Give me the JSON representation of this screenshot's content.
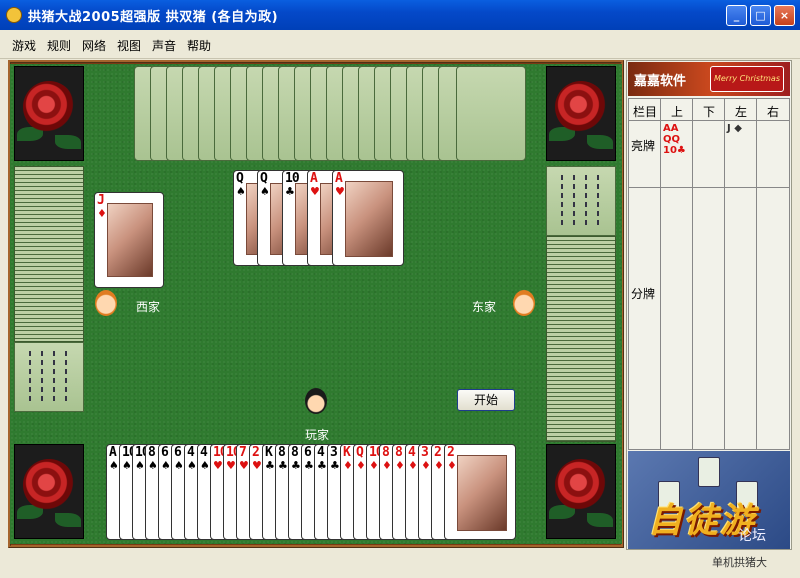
{
  "window": {
    "title": "拱猪大战2005超强版  拱双猪 (各自为政)",
    "min_label": "_",
    "max_label": "□",
    "close_label": "×"
  },
  "menu": [
    "游戏",
    "规则",
    "网络",
    "视图",
    "声音",
    "帮助"
  ],
  "players": {
    "west": "西家",
    "east": "东家",
    "me": "玩家"
  },
  "start_button": "开始",
  "west_card": {
    "rank": "J",
    "suit": "♦",
    "color": "red"
  },
  "table_cards": [
    {
      "rank": "Q",
      "suit": "♠",
      "color": "black"
    },
    {
      "rank": "Q",
      "suit": "♠",
      "color": "black"
    },
    {
      "rank": "10",
      "suit": "♣",
      "color": "black"
    },
    {
      "rank": "A",
      "suit": "♥",
      "color": "red"
    },
    {
      "rank": "A",
      "suit": "♥",
      "color": "red"
    }
  ],
  "hand": [
    {
      "rank": "A",
      "suit": "♠",
      "color": "black"
    },
    {
      "rank": "10",
      "suit": "♠",
      "color": "black"
    },
    {
      "rank": "10",
      "suit": "♠",
      "color": "black"
    },
    {
      "rank": "8",
      "suit": "♠",
      "color": "black"
    },
    {
      "rank": "6",
      "suit": "♠",
      "color": "black"
    },
    {
      "rank": "6",
      "suit": "♠",
      "color": "black"
    },
    {
      "rank": "4",
      "suit": "♠",
      "color": "black"
    },
    {
      "rank": "4",
      "suit": "♠",
      "color": "black"
    },
    {
      "rank": "10",
      "suit": "♥",
      "color": "red"
    },
    {
      "rank": "10",
      "suit": "♥",
      "color": "red"
    },
    {
      "rank": "7",
      "suit": "♥",
      "color": "red"
    },
    {
      "rank": "2",
      "suit": "♥",
      "color": "red"
    },
    {
      "rank": "K",
      "suit": "♣",
      "color": "black"
    },
    {
      "rank": "8",
      "suit": "♣",
      "color": "black"
    },
    {
      "rank": "8",
      "suit": "♣",
      "color": "black"
    },
    {
      "rank": "6",
      "suit": "♣",
      "color": "black"
    },
    {
      "rank": "4",
      "suit": "♣",
      "color": "black"
    },
    {
      "rank": "3",
      "suit": "♣",
      "color": "black"
    },
    {
      "rank": "K",
      "suit": "♦",
      "color": "red"
    },
    {
      "rank": "Q",
      "suit": "♦",
      "color": "red"
    },
    {
      "rank": "10",
      "suit": "♦",
      "color": "red"
    },
    {
      "rank": "8",
      "suit": "♦",
      "color": "red"
    },
    {
      "rank": "8",
      "suit": "♦",
      "color": "red"
    },
    {
      "rank": "4",
      "suit": "♦",
      "color": "red"
    },
    {
      "rank": "3",
      "suit": "♦",
      "color": "red"
    },
    {
      "rank": "2",
      "suit": "♦",
      "color": "red"
    }
  ],
  "last_hand_card": {
    "rank": "2",
    "suit": "♦",
    "color": "red"
  },
  "panel": {
    "brand": "嘉嘉软件",
    "xmas": "Merry Christmas",
    "columns": [
      "栏目",
      "上",
      "下",
      "左",
      "右"
    ],
    "rows": [
      "亮牌",
      "分牌"
    ],
    "shown_up": "AA\nQQ\n10♣",
    "shown_left": "J ◆",
    "logo": "自徒游",
    "watermark": "论坛",
    "status": "单机拱猪大"
  }
}
